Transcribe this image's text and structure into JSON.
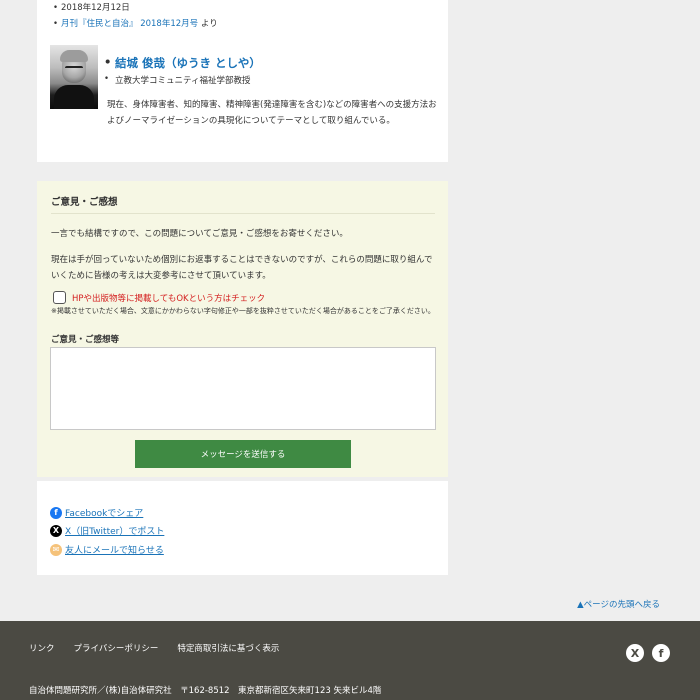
{
  "article_meta": {
    "date": "2018年12月12日",
    "source_link": "月刊『住民と自治』 2018年12月号",
    "source_suffix": " より"
  },
  "author": {
    "name": "結城 俊哉（ゆうき としや）",
    "title": "立教大学コミュニティ福祉学部教授",
    "bio": "現在、身体障害者、知的障害、精神障害(発達障害を含む)などの障害者への支援方法およびノーマライゼーションの具現化についてテーマとして取り組んでいる。"
  },
  "feedback": {
    "heading": "ご意見・ご感想",
    "intro": "一言でも結構ですので、この問題についてご意見・ご感想をお寄せください。",
    "notice": "現在は手が回っていないため個別にお返事することはできないのですが、これらの問題に取り組んでいくために皆様の考えは大変参考にさせて頂いています。",
    "consent_label": "HPや出版物等に掲載してもOKという方はチェック",
    "consent_note": "※掲載させていただく場合、文意にかかわらない字句修正や一部を抜粋させていただく場合があることをご了承ください。",
    "comment_label": "ご意見・ご感想等",
    "comment_value": "",
    "submit_label": "メッセージを送信する"
  },
  "share": {
    "facebook_label": "Facebookでシェア",
    "x_label": "X（旧Twitter）でポスト",
    "mail_label": "友人にメールで知らせる"
  },
  "page_top_label": "▲ページの先頭へ戻る",
  "footer": {
    "links": [
      "リンク",
      "プライバシーポリシー",
      "特定商取引法に基づく表示"
    ],
    "address": "自治体問題研究所／(株)自治体研究社　〒162-8512　東京都新宿区矢来町123 矢来ビル4階"
  },
  "icons": {
    "facebook": "facebook-icon",
    "x": "x-icon",
    "mail": "mail-icon"
  },
  "colors": {
    "link": "#1a73b8",
    "submit": "#3f8a43",
    "consent": "#d42020",
    "footer_bg": "#4b4a43",
    "form_bg": "#f6f7e4"
  }
}
